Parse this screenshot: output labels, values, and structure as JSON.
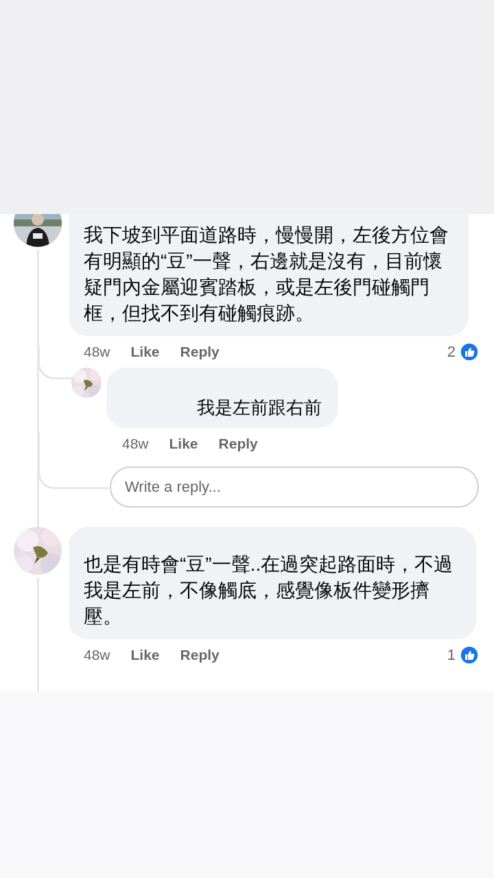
{
  "comments": [
    {
      "text": "我下坡到平面道路時，慢慢開，左後方位會有明顯的“豆”一聲，右邊就是沒有，目前懷疑門內金屬迎賓踏板，或是左後門碰觸門框，但找不到有碰觸痕跡。",
      "time": "48w",
      "actions": [
        "Like",
        "Reply"
      ],
      "reaction_count": "2",
      "replies": [
        {
          "text": "我是左前跟右前",
          "time": "48w",
          "actions": [
            "Like",
            "Reply"
          ]
        }
      ],
      "reply_field": {
        "placeholder": "Write a reply..."
      }
    },
    {
      "text": "也是有時會“豆”一聲..在過突起路面時，不過我是左前，不像觸底，感覺像板件變形擠壓。",
      "time": "48w",
      "actions": [
        "Like",
        "Reply"
      ],
      "reaction_count": "1"
    }
  ]
}
